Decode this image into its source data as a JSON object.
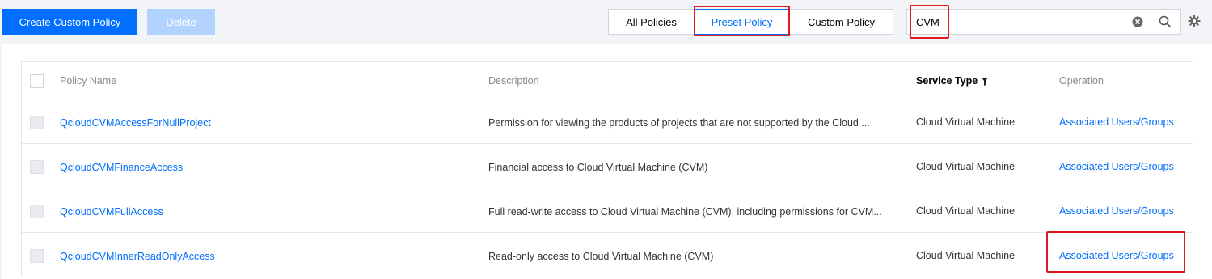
{
  "toolbar": {
    "create_label": "Create Custom Policy",
    "delete_label": "Delete",
    "tabs": [
      "All Policies",
      "Preset Policy",
      "Custom Policy"
    ],
    "active_tab": "Preset Policy",
    "search_value": "CVM"
  },
  "table": {
    "headers": {
      "name": "Policy Name",
      "description": "Description",
      "service_type": "Service Type",
      "operation": "Operation"
    },
    "rows": [
      {
        "name": "QcloudCVMAccessForNullProject",
        "description": "Permission for viewing the products of projects that are not supported by the Cloud ...",
        "service_type": "Cloud Virtual Machine",
        "operation": "Associated Users/Groups"
      },
      {
        "name": "QcloudCVMFinanceAccess",
        "description": "Financial access to Cloud Virtual Machine (CVM)",
        "service_type": "Cloud Virtual Machine",
        "operation": "Associated Users/Groups"
      },
      {
        "name": "QcloudCVMFullAccess",
        "description": "Full read-write access to Cloud Virtual Machine (CVM), including permissions for CVM...",
        "service_type": "Cloud Virtual Machine",
        "operation": "Associated Users/Groups"
      },
      {
        "name": "QcloudCVMInnerReadOnlyAccess",
        "description": "Read-only access to Cloud Virtual Machine (CVM)",
        "service_type": "Cloud Virtual Machine",
        "operation": "Associated Users/Groups"
      }
    ]
  },
  "colors": {
    "primary": "#006eff",
    "disabled": "#b2d2ff",
    "highlight": "#e1191e"
  },
  "icons": [
    "clear-icon",
    "search-icon",
    "gear-icon",
    "filter-icon"
  ]
}
